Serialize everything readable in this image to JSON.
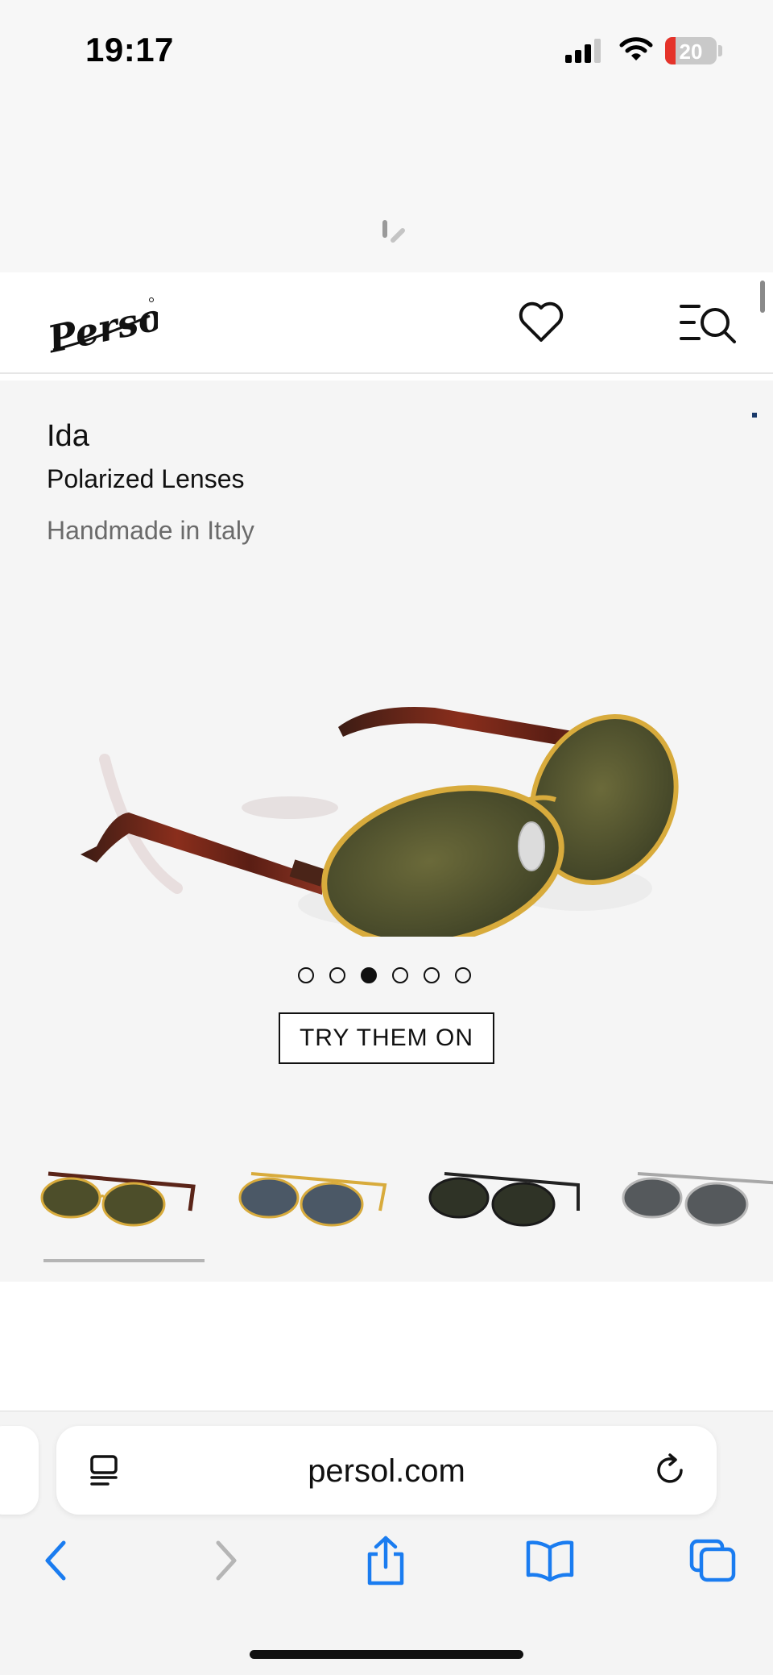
{
  "status_bar": {
    "time": "19:17",
    "battery_level": "20",
    "battery_fraction": 0.2,
    "icons": [
      "cellular-signal-icon",
      "wifi-icon",
      "battery-icon"
    ]
  },
  "header": {
    "brand": "Persol",
    "icons": [
      "heart-icon",
      "menu-search-icon"
    ]
  },
  "product": {
    "name": "Ida",
    "lens": "Polarized Lenses",
    "origin": "Handmade in Italy",
    "carousel": {
      "total": 6,
      "active_index": 2
    },
    "try_on_label": "TRY THEM ON",
    "variants": [
      {
        "frame": "gold",
        "lens": "green",
        "temple": "havana",
        "selected": true
      },
      {
        "frame": "gold",
        "lens": "blue",
        "temple": "gold",
        "selected": false
      },
      {
        "frame": "black",
        "lens": "green",
        "temple": "black",
        "selected": false
      },
      {
        "frame": "silver",
        "lens": "grey",
        "temple": "silver",
        "selected": false
      }
    ]
  },
  "browser": {
    "url": "persol.com",
    "toolbar": [
      "back-icon",
      "forward-icon",
      "share-icon",
      "bookmarks-icon",
      "tabs-icon"
    ],
    "accent_color": "#1a7cf0",
    "disabled_color": "#b5b5b5"
  }
}
